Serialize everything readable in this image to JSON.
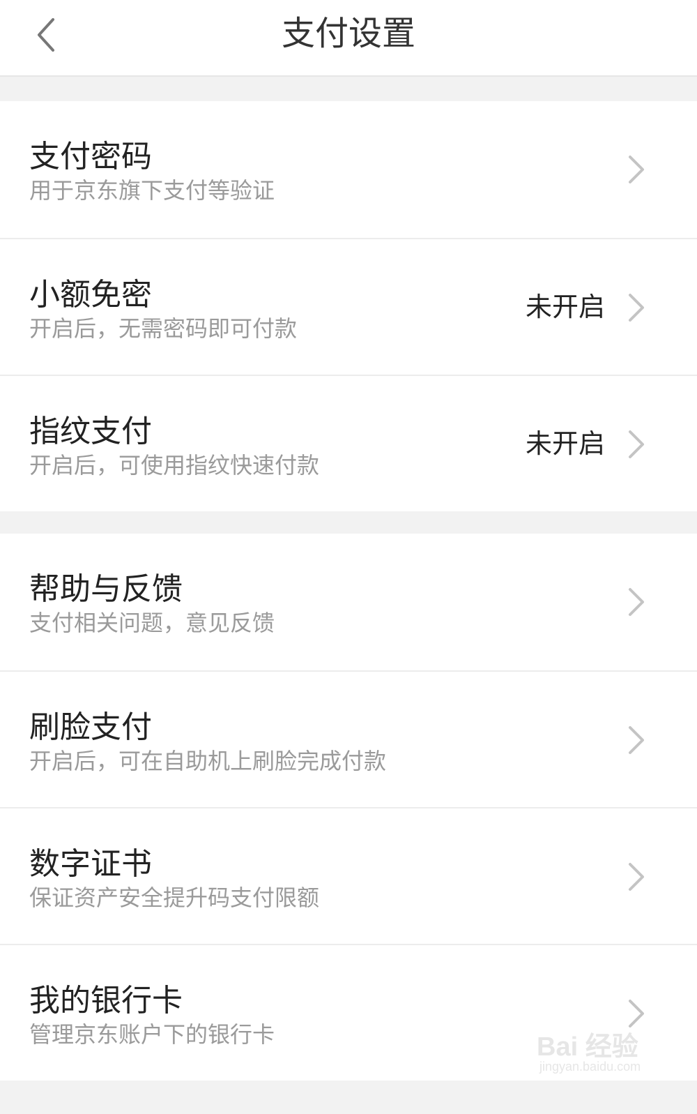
{
  "header": {
    "title": "支付设置",
    "back_icon": "chevron-left-icon"
  },
  "settings_group_1": [
    {
      "title": "支付密码",
      "subtitle": "用于京东旗下支付等验证",
      "status": ""
    },
    {
      "title": "小额免密",
      "subtitle": "开启后，无需密码即可付款",
      "status": "未开启"
    },
    {
      "title": "指纹支付",
      "subtitle": "开启后，可使用指纹快速付款",
      "status": "未开启"
    }
  ],
  "settings_group_2": [
    {
      "title": "帮助与反馈",
      "subtitle": "支付相关问题，意见反馈"
    },
    {
      "title": "刷脸支付",
      "subtitle": "开启后，可在自助机上刷脸完成付款"
    },
    {
      "title": "数字证书",
      "subtitle": "保证资产安全提升码支付限额"
    },
    {
      "title": "我的银行卡",
      "subtitle": "管理京东账户下的银行卡"
    }
  ],
  "watermark": {
    "logo": "Bai 经验",
    "url": "jingyan.baidu.com"
  },
  "colors": {
    "background": "#f2f2f2",
    "card": "#ffffff",
    "title_text": "#222222",
    "subtitle_text": "#9a9a9a",
    "chevron": "#c4c4c4"
  }
}
